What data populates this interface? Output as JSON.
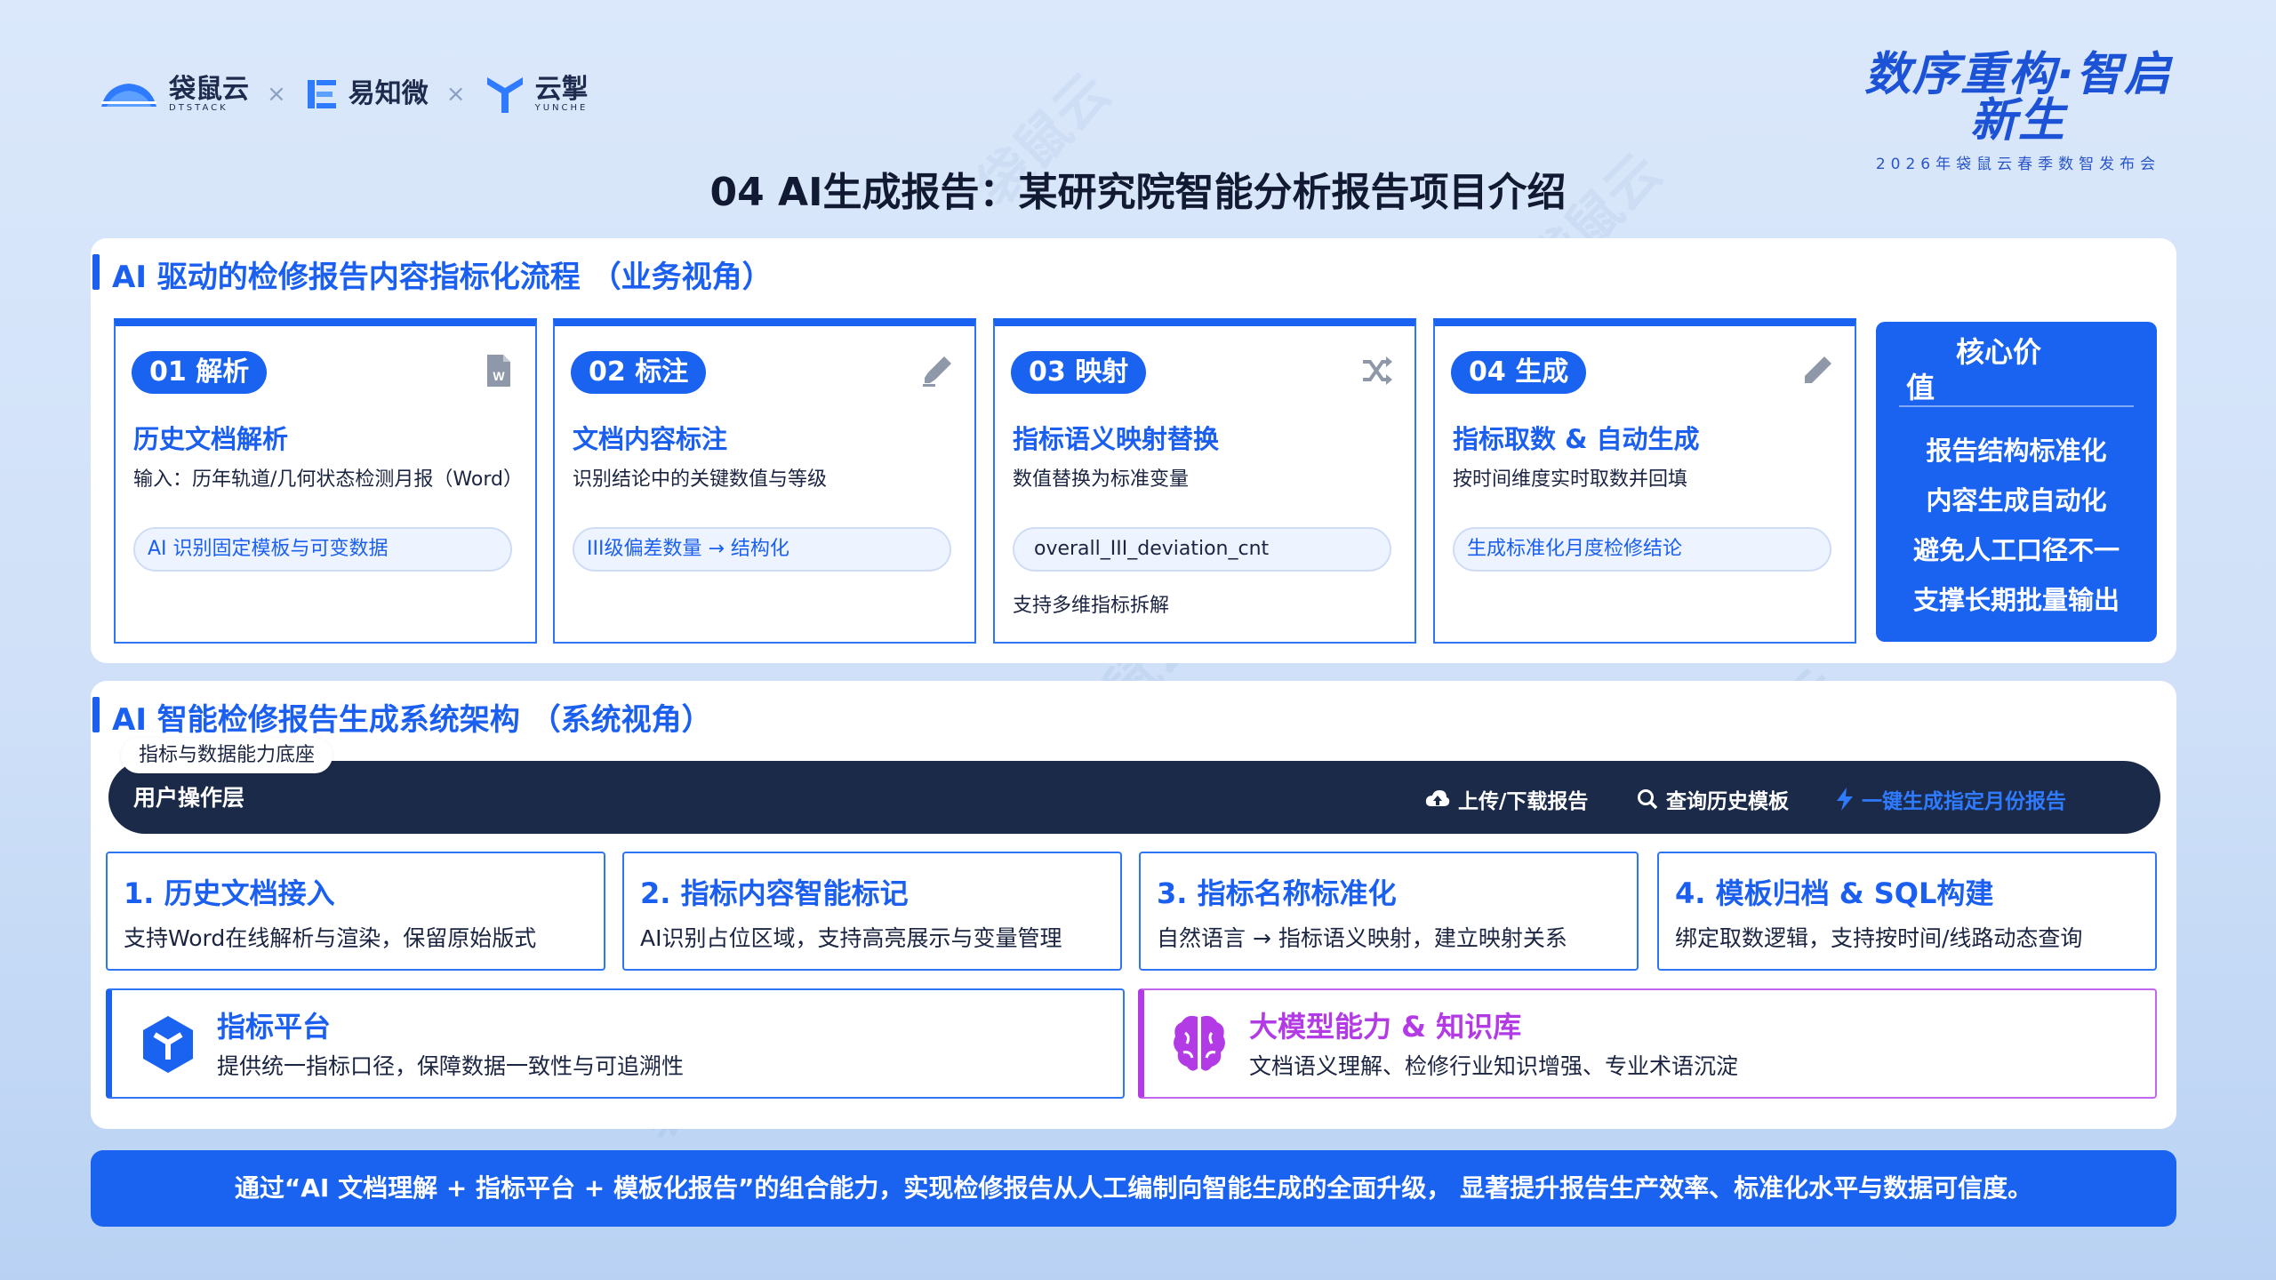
{
  "header": {
    "logos": [
      {
        "name": "袋鼠云",
        "sub": "DTSTACK"
      },
      {
        "name": "易知微",
        "sub": ""
      },
      {
        "name": "云掣",
        "sub": "YUNCHE"
      }
    ],
    "separator": "×",
    "brand_title": "数序重构·智启新生",
    "brand_subtitle": "2026年袋鼠云春季数智发布会",
    "watermark": "袋鼠云"
  },
  "page_title": "04 AI生成报告：某研究院智能分析报告项目介绍",
  "section1": {
    "title": "AI 驱动的检修报告内容指标化流程 （业务视角）",
    "steps": [
      {
        "badge": "01 解析",
        "icon": "word-doc-icon",
        "title": "历史文档解析",
        "desc": "输入：历年轨道/几何状态检测月报（Word）",
        "chip": "AI 识别固定模板与可变数据",
        "extra": ""
      },
      {
        "badge": "02 标注",
        "icon": "highlighter-icon",
        "title": "文档内容标注",
        "desc": "识别结论中的关键数值与等级",
        "chip": "III级偏差数量 → 结构化",
        "extra": ""
      },
      {
        "badge": "03 映射",
        "icon": "shuffle-icon",
        "title": "指标语义映射替换",
        "desc": "数值替换为标准变量",
        "chip": "overall_III_deviation_cnt",
        "extra": "支持多维指标拆解"
      },
      {
        "badge": "04 生成",
        "icon": "pencil-icon",
        "title": "指标取数 & 自动生成",
        "desc": "按时间维度实时取数并回填",
        "chip": "生成标准化月度检修结论",
        "extra": ""
      }
    ],
    "core_value": {
      "title_line1": "核心价",
      "title_line2": "值",
      "items": [
        "报告结构标准化",
        "内容生成自动化",
        "避免人工口径不一",
        "支撑长期批量输出"
      ]
    }
  },
  "section2": {
    "title": "AI 智能检修报告生成系统架构 （系统视角）",
    "tag": "指标与数据能力底座",
    "user_layer": "用户操作层",
    "actions": [
      {
        "label": "上传/下载报告",
        "icon": "cloud-upload-icon"
      },
      {
        "label": "查询历史模板",
        "icon": "search-icon"
      },
      {
        "label": "一键生成指定月份报告",
        "icon": "lightning-icon"
      }
    ],
    "modules": [
      {
        "title": "1. 历史文档接入",
        "desc": "支持Word在线解析与渲染，保留原始版式"
      },
      {
        "title": "2. 指标内容智能标记",
        "desc": "AI识别占位区域，支持高亮展示与变量管理"
      },
      {
        "title": "3. 指标名称标准化",
        "desc": "自然语言 → 指标语义映射，建立映射关系"
      },
      {
        "title": "4. 模板归档 & SQL构建",
        "desc": "绑定取数逻辑，支持按时间/线路动态查询"
      }
    ],
    "platform": {
      "title": "指标平台",
      "desc": "提供统一指标口径，保障数据一致性与可追溯性",
      "icon": "cube-icon"
    },
    "llm": {
      "title": "大模型能力 & 知识库",
      "desc": "文档语义理解、检修行业知识增强、专业术语沉淀",
      "icon": "brain-icon"
    }
  },
  "summary": "通过“AI 文档理解 + 指标平台 + 模板化报告”的组合能力，实现检修报告从人工编制向智能生成的全面升级， 显著提升报告生产效率、标准化水平与数据可信度。",
  "colors": {
    "accent": "#1a63f1",
    "dark_bar": "#1b2a48",
    "llm_purple": "#b23be6",
    "page_bg": "#d4e4f9"
  }
}
